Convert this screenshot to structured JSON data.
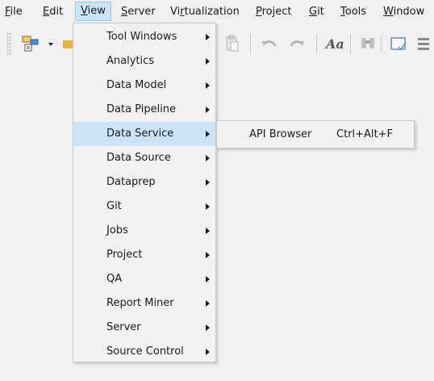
{
  "menubar": {
    "items": [
      {
        "label": "File",
        "accel_index": 0
      },
      {
        "label": "Edit",
        "accel_index": 0
      },
      {
        "label": "View",
        "accel_index": 0
      },
      {
        "label": "Server",
        "accel_index": 0
      },
      {
        "label": "Virtualization",
        "accel_index": 2
      },
      {
        "label": "Project",
        "accel_index": 0
      },
      {
        "label": "Git",
        "accel_index": 0
      },
      {
        "label": "Tools",
        "accel_index": 0
      },
      {
        "label": "Window",
        "accel_index": 0
      }
    ],
    "active": "View"
  },
  "toolbar": {
    "icons": [
      "new-project-icon",
      "dropdown-icon",
      "open-folder-icon",
      "paste-icon",
      "undo-icon",
      "redo-icon",
      "font-icon",
      "find-icon",
      "window-icon"
    ]
  },
  "view_menu": {
    "items": [
      {
        "label": "Tool Windows",
        "has_submenu": true
      },
      {
        "label": "Analytics",
        "has_submenu": true
      },
      {
        "label": "Data Model",
        "has_submenu": true
      },
      {
        "label": "Data Pipeline",
        "has_submenu": true
      },
      {
        "label": "Data Service",
        "has_submenu": true,
        "selected": true
      },
      {
        "label": "Data Source",
        "has_submenu": true
      },
      {
        "label": "Dataprep",
        "has_submenu": true
      },
      {
        "label": "Git",
        "has_submenu": true
      },
      {
        "label": "Jobs",
        "has_submenu": true
      },
      {
        "label": "Project",
        "has_submenu": true
      },
      {
        "label": "QA",
        "has_submenu": true
      },
      {
        "label": "Report Miner",
        "has_submenu": true
      },
      {
        "label": "Server",
        "has_submenu": true
      },
      {
        "label": "Source Control",
        "has_submenu": true
      }
    ]
  },
  "submenu": {
    "items": [
      {
        "label": "API Browser",
        "shortcut": "Ctrl+Alt+F"
      }
    ]
  },
  "colors": {
    "background": "#f0f0f0",
    "menu_background": "#f2f2f2",
    "highlight": "#cce4f7",
    "highlight_border": "#99c9ef",
    "border": "#c9c9c9"
  }
}
